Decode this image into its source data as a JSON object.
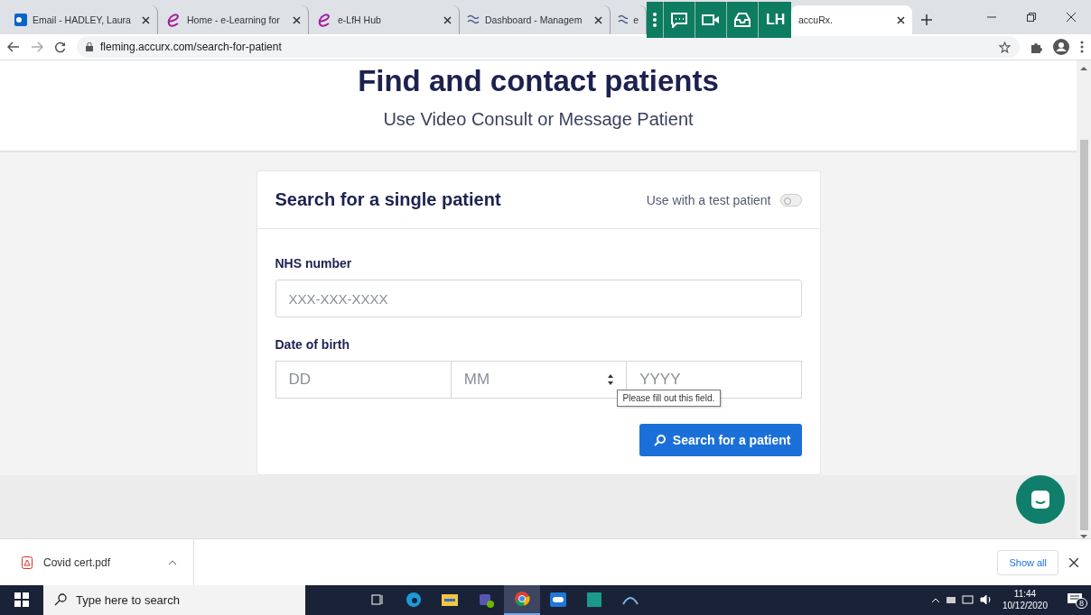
{
  "browser": {
    "tabs": [
      {
        "title": "Email - HADLEY, Laura",
        "kind": "mail",
        "selected": false
      },
      {
        "title": "Home - e-Learning for",
        "kind": "elearning",
        "selected": false
      },
      {
        "title": "e-LfH Hub",
        "kind": "elearning",
        "selected": false
      },
      {
        "title": "Dashboard - Managem",
        "kind": "waves",
        "selected": false
      },
      {
        "title": "e",
        "kind": "waves",
        "selected": false
      },
      {
        "title": "accuRx.",
        "kind": "plain",
        "selected": true
      }
    ],
    "address": "fleming.accurx.com/search-for-patient"
  },
  "overlay_toolbar": {
    "initials": "LH"
  },
  "page": {
    "heading": "Find and contact patients",
    "subheading": "Use Video Consult or Message Patient",
    "card": {
      "title": "Search for a single patient",
      "toggle_label": "Use with a test patient",
      "toggle_on": false,
      "nhs_label": "NHS number",
      "nhs_placeholder": "XXX-XXX-XXXX",
      "dob_label": "Date of birth",
      "dob_fields": [
        {
          "placeholder": "DD"
        },
        {
          "placeholder": "MM"
        },
        {
          "placeholder": "YYYY"
        }
      ],
      "tooltip": "Please fill out this field.",
      "button": "Search for a patient"
    }
  },
  "downloads": {
    "file": "Covid cert.pdf",
    "show_all": "Show all"
  },
  "taskbar": {
    "search_placeholder": "Type here to search",
    "apps": [
      {
        "kind": "taskview",
        "active": false
      },
      {
        "kind": "edge",
        "active": false
      },
      {
        "kind": "explorer",
        "active": false
      },
      {
        "kind": "teams",
        "active": false
      },
      {
        "kind": "chrome",
        "active": true
      },
      {
        "kind": "blueapp",
        "active": false
      },
      {
        "kind": "greenapp",
        "active": false
      },
      {
        "kind": "network",
        "active": false
      }
    ],
    "time": "11:44",
    "date": "10/12/2020",
    "notifications": "8"
  }
}
